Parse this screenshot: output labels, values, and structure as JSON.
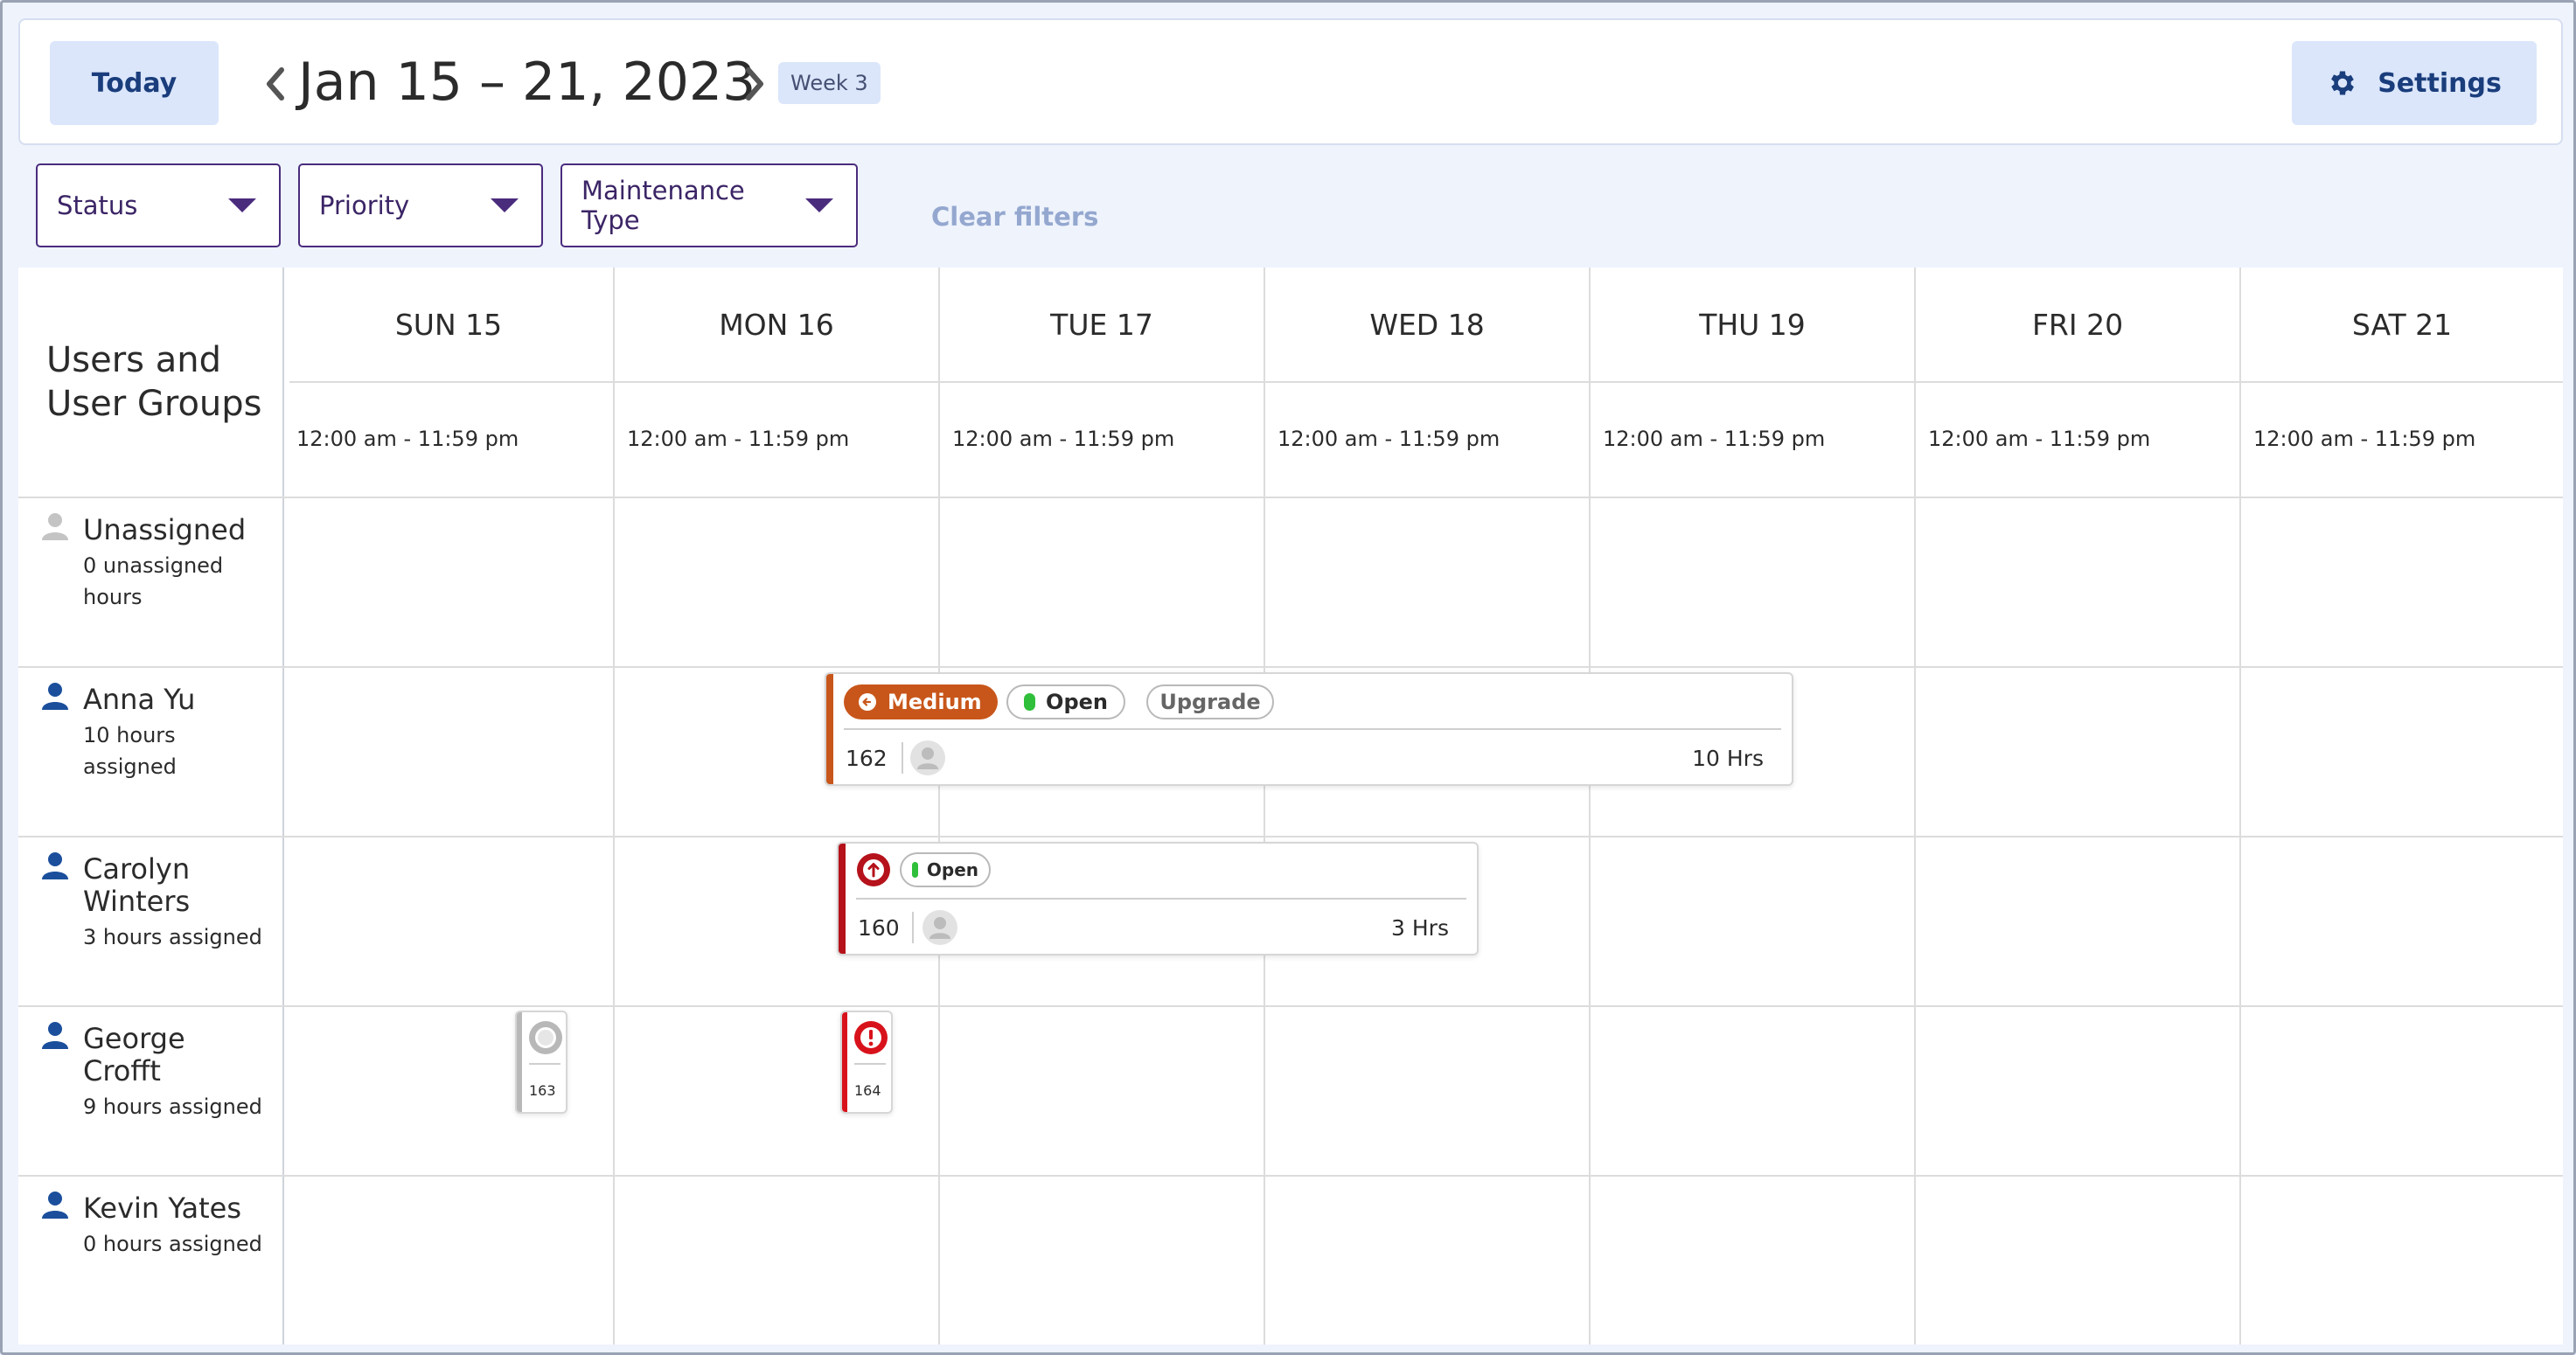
{
  "header": {
    "today_label": "Today",
    "date_range": "Jan 15 – 21, 2023",
    "week_badge": "Week 3",
    "settings_label": "Settings",
    "prev_icon": "chevron-left-icon",
    "next_icon": "chevron-right-icon",
    "settings_icon": "gear-icon"
  },
  "filters": {
    "status_label": "Status",
    "priority_label": "Priority",
    "maintenance_type_label": "Maintenance Type",
    "clear_label": "Clear filters"
  },
  "grid": {
    "sidebar_title": "Users and\nUser Groups",
    "days": [
      {
        "label": "SUN 15",
        "time": "12:00 am - 11:59 pm"
      },
      {
        "label": "MON 16",
        "time": "12:00 am - 11:59 pm"
      },
      {
        "label": "TUE 17",
        "time": "12:00 am - 11:59 pm"
      },
      {
        "label": "WED 18",
        "time": "12:00 am - 11:59 pm"
      },
      {
        "label": "THU 19",
        "time": "12:00 am - 11:59 pm"
      },
      {
        "label": "FRI 20",
        "time": "12:00 am - 11:59 pm"
      },
      {
        "label": "SAT 21",
        "time": "12:00 am - 11:59 pm"
      }
    ],
    "users": [
      {
        "name": "Unassigned",
        "hours": "0 unassigned\nhours",
        "icon": "user-icon-gray"
      },
      {
        "name": "Anna Yu",
        "hours": "10 hours\nassigned",
        "icon": "user-icon-blue"
      },
      {
        "name": "Carolyn\nWinters",
        "hours": "3 hours assigned",
        "icon": "user-icon-blue"
      },
      {
        "name": "George\nCrofft",
        "hours": "9 hours assigned",
        "icon": "user-icon-blue"
      },
      {
        "name": "Kevin Yates",
        "hours": "0 hours assigned",
        "icon": "user-icon-blue"
      }
    ]
  },
  "work_orders": {
    "wo_162": {
      "priority_label": "Medium",
      "status_label": "Open",
      "type_label": "Upgrade",
      "id": "162",
      "hours": "10 Hrs",
      "priority_color": "#c8561a",
      "status_dot_color": "#2fbf3a"
    },
    "wo_160": {
      "status_label": "Open",
      "id": "160",
      "hours": "3 Hrs",
      "priority_color": "#b5121b",
      "status_dot_color": "#2fbf3a"
    },
    "wo_163": {
      "id": "163",
      "bar_color": "#b8b8b8"
    },
    "wo_164": {
      "id": "164",
      "bar_color": "#d8121b"
    }
  },
  "colors": {
    "accent": "#1a3d7c",
    "filter_border": "#4a2c7d",
    "user_blue": "#1b4f9c",
    "user_gray": "#c4c4c4"
  }
}
